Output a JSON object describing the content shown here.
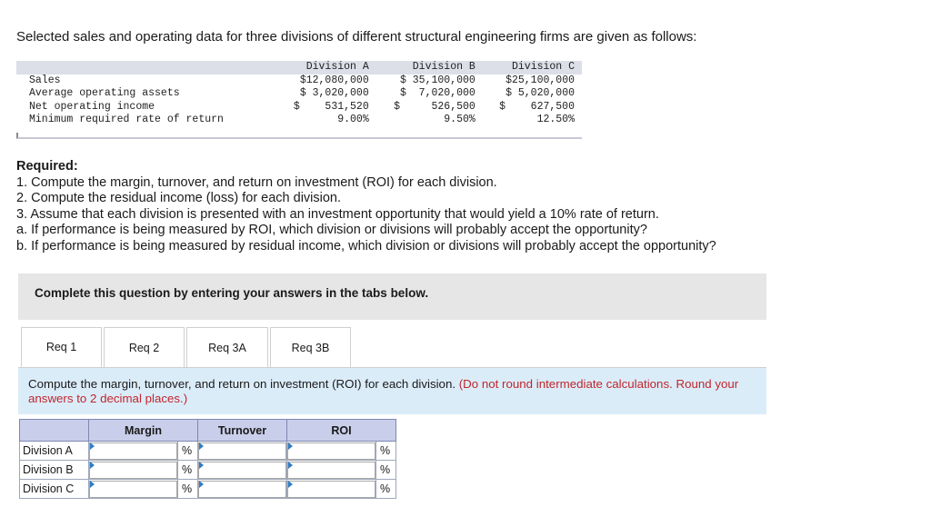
{
  "intro": "Selected sales and operating data for three divisions of different structural engineering firms are given as follows:",
  "data_table": {
    "headers": [
      "Division A",
      "Division B",
      "Division C"
    ],
    "rows": [
      {
        "label": "Sales",
        "values": [
          "$12,080,000",
          "$ 35,100,000",
          "$25,100,000"
        ]
      },
      {
        "label": "Average operating assets",
        "values": [
          "$ 3,020,000",
          "$  7,020,000",
          "$ 5,020,000"
        ]
      },
      {
        "label": "Net operating income",
        "values": [
          "$    531,520",
          "$     526,500",
          "$    627,500"
        ]
      },
      {
        "label": "Minimum required rate of return",
        "values": [
          "9.00%",
          "9.50%",
          "12.50%"
        ]
      }
    ]
  },
  "required": {
    "heading": "Required:",
    "lines": [
      "1. Compute the margin, turnover, and return on investment (ROI) for each division.",
      "2. Compute the residual income (loss) for each division.",
      "3. Assume that each division is presented with an investment opportunity that would yield a 10% rate of return.",
      "a. If performance is being measured by ROI, which division or divisions will probably accept the opportunity?",
      "b. If performance is being measured by residual income, which division or divisions will probably accept the opportunity?"
    ]
  },
  "banner": "Complete this question by entering your answers in the tabs below.",
  "tabs": [
    "Req 1",
    "Req 2",
    "Req 3A",
    "Req 3B"
  ],
  "instruction": {
    "text": "Compute the margin, turnover, and return on investment (ROI) for each division.",
    "note": "(Do not round intermediate calculations. Round your answers to 2 decimal places.)"
  },
  "answer_grid": {
    "columns": [
      "Margin",
      "Turnover",
      "ROI"
    ],
    "rows": [
      "Division A",
      "Division B",
      "Division C"
    ],
    "unit": "%"
  }
}
